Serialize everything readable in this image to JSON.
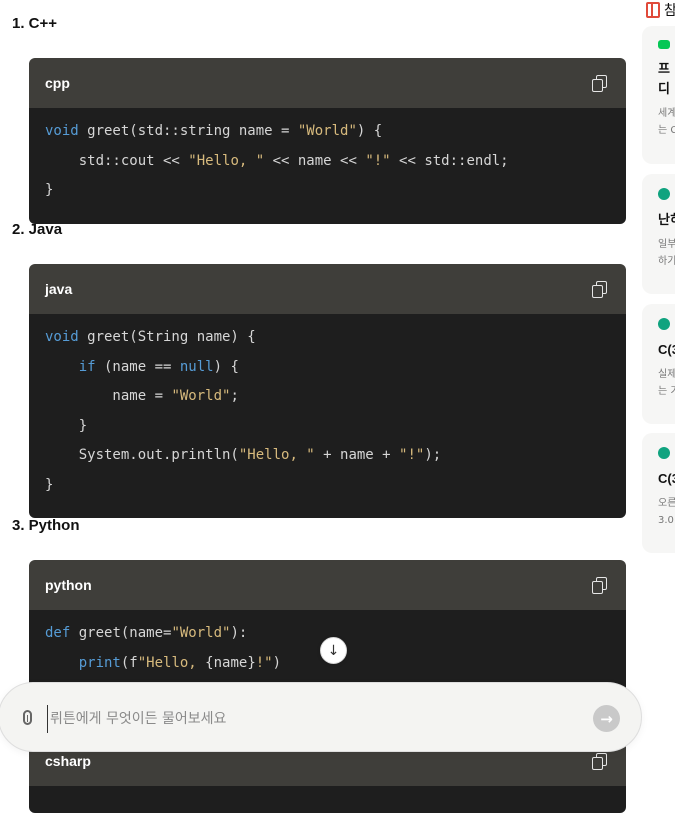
{
  "sections": [
    {
      "heading": "1. C++",
      "lang": "cpp",
      "lines": [
        [
          {
            "t": "void",
            "k": "kw"
          },
          {
            "t": " greet(std::string name = "
          },
          {
            "t": "\"World\"",
            "k": "str"
          },
          {
            "t": ") {"
          }
        ],
        [
          {
            "t": "    std::cout << "
          },
          {
            "t": "\"Hello, \"",
            "k": "str"
          },
          {
            "t": " << name << "
          },
          {
            "t": "\"!\"",
            "k": "str"
          },
          {
            "t": " << std::endl;"
          }
        ],
        [
          {
            "t": "}"
          }
        ]
      ]
    },
    {
      "heading": "2. Java",
      "lang": "java",
      "lines": [
        [
          {
            "t": "void",
            "k": "kw"
          },
          {
            "t": " greet(String name) {"
          }
        ],
        [
          {
            "t": "    "
          },
          {
            "t": "if",
            "k": "kw"
          },
          {
            "t": " (name == "
          },
          {
            "t": "null",
            "k": "kw"
          },
          {
            "t": ") {"
          }
        ],
        [
          {
            "t": "        name = "
          },
          {
            "t": "\"World\"",
            "k": "str"
          },
          {
            "t": ";"
          }
        ],
        [
          {
            "t": "    }"
          }
        ],
        [
          {
            "t": "    System.out.println("
          },
          {
            "t": "\"Hello, \"",
            "k": "str"
          },
          {
            "t": " + name + "
          },
          {
            "t": "\"!\"",
            "k": "str"
          },
          {
            "t": ");"
          }
        ],
        [
          {
            "t": "}"
          }
        ]
      ]
    },
    {
      "heading": "3. Python",
      "lang": "python",
      "lines": [
        [
          {
            "t": "def",
            "k": "kw"
          },
          {
            "t": " greet(name="
          },
          {
            "t": "\"World\"",
            "k": "str"
          },
          {
            "t": "):"
          }
        ],
        [
          {
            "t": "    "
          },
          {
            "t": "print",
            "k": "kw"
          },
          {
            "t": "(f"
          },
          {
            "t": "\"Hello, ",
            "k": "str"
          },
          {
            "t": "{name}"
          },
          {
            "t": "!\"",
            "k": "str"
          },
          {
            "t": ")"
          }
        ]
      ]
    },
    {
      "heading": "",
      "lang": "csharp",
      "lines": []
    }
  ],
  "sidebar": {
    "title": "참",
    "cards": [
      {
        "icon": "line",
        "title": "프\n디",
        "sub": "세계\n는 C"
      },
      {
        "icon": "green",
        "title": "난히",
        "sub": "일부\n하기"
      },
      {
        "icon": "green",
        "title": "C(3",
        "sub": "실제\n는 기"
      },
      {
        "icon": "green",
        "title": "C(3",
        "sub": "오른\n3.0"
      }
    ]
  },
  "input": {
    "placeholder": "뤼튼에게 무엇이든 물어보세요",
    "value": ""
  },
  "icons": {
    "send": "→",
    "scroll": "↓"
  },
  "colors": {
    "keyword": "#569cd6",
    "string": "#d7ba7d",
    "code_bg": "#1e1e1e",
    "header_bg": "#3f3e3a"
  }
}
